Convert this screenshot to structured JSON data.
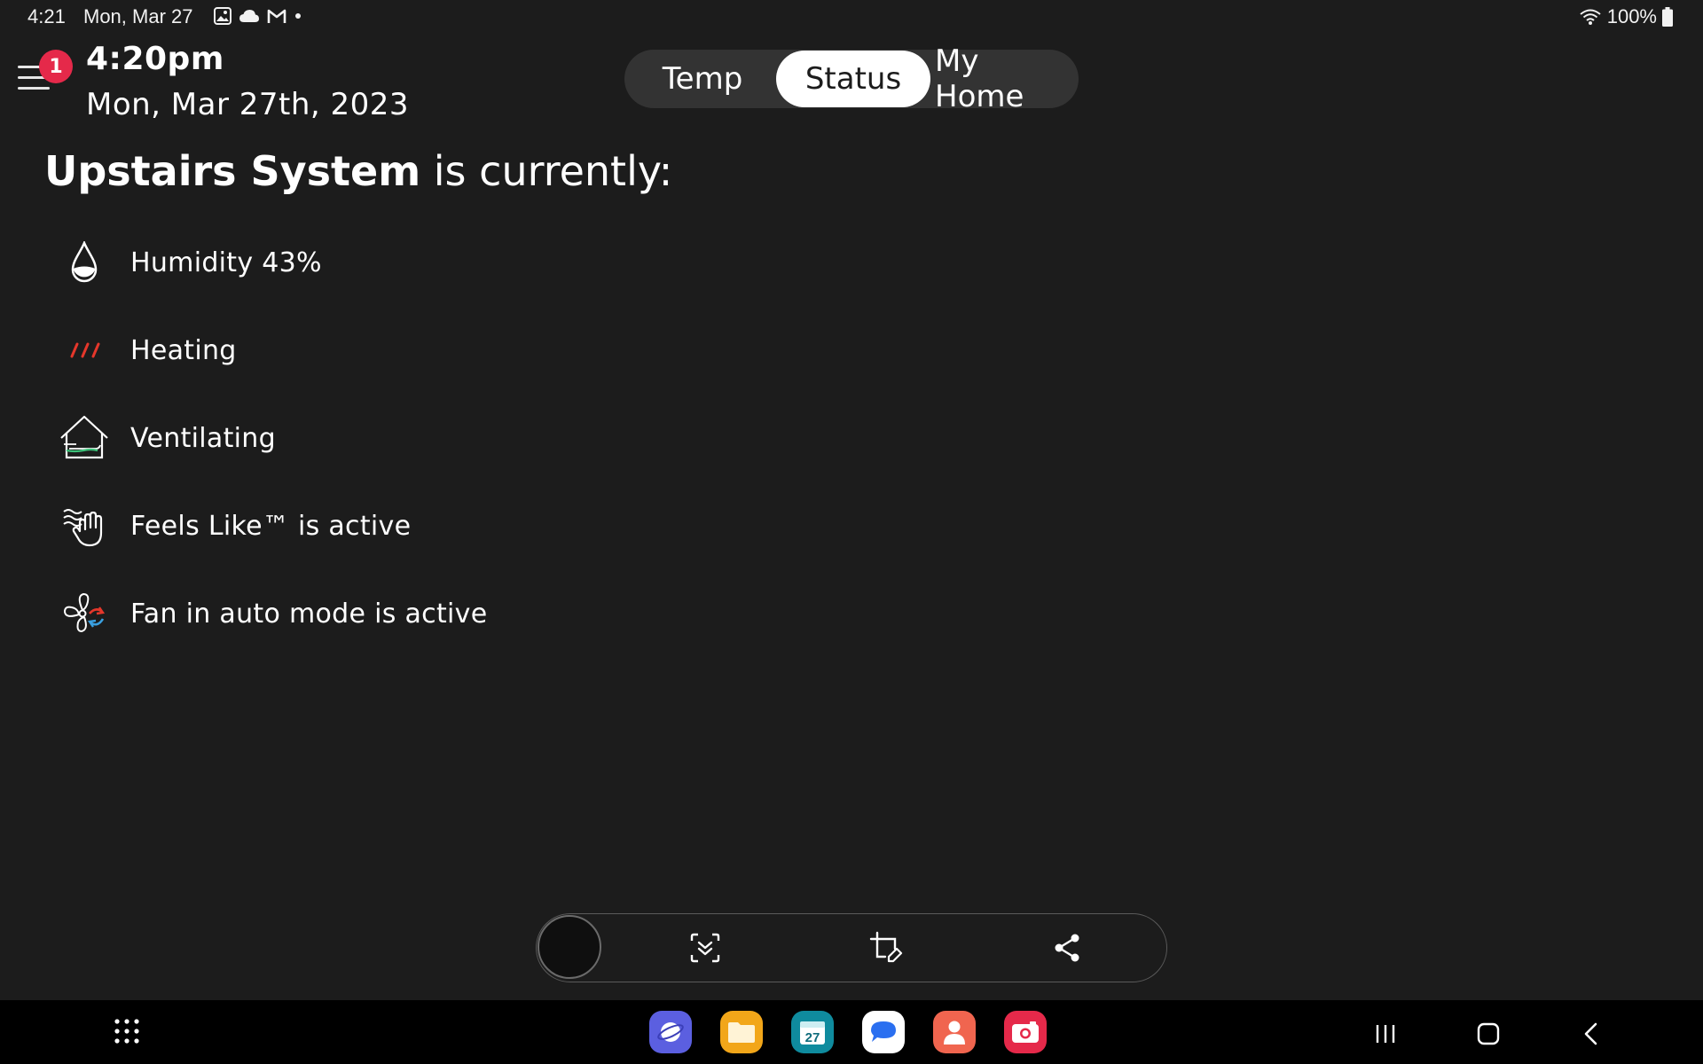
{
  "statusbar": {
    "time": "4:21",
    "date": "Mon, Mar 27",
    "battery": "100%",
    "icons": [
      "gallery-icon",
      "cloud-icon",
      "gmail-icon",
      "dot-icon",
      "wifi-icon",
      "battery-icon"
    ]
  },
  "header": {
    "notification_count": "1",
    "time": "4:20pm",
    "date": "Mon, Mar 27th, 2023"
  },
  "tabs": [
    {
      "label": "Temp",
      "selected": false
    },
    {
      "label": "Status",
      "selected": true
    },
    {
      "label": "My Home",
      "selected": false
    }
  ],
  "system": {
    "name": "Upstairs System",
    "suffix": " is currently:"
  },
  "status_items": [
    {
      "icon": "water-drop-icon",
      "label": "Humidity 43%"
    },
    {
      "icon": "heating-icon",
      "label": "Heating"
    },
    {
      "icon": "ventilation-house-icon",
      "label": "Ventilating"
    },
    {
      "icon": "feels-like-hand-icon",
      "label": "Feels Like™ is active"
    },
    {
      "icon": "fan-auto-icon",
      "label": "Fan in auto mode is active"
    }
  ],
  "screenshot_toolbar": {
    "tools": [
      "scroll-capture-icon",
      "crop-edit-icon",
      "share-icon"
    ]
  },
  "dock": {
    "apps": [
      {
        "name": "internet",
        "color": "#5b5fe0"
      },
      {
        "name": "my-files",
        "color": "#f2a619"
      },
      {
        "name": "calendar",
        "color": "#0f8b9e",
        "text": "27"
      },
      {
        "name": "messages",
        "color": "#ffffff"
      },
      {
        "name": "contacts",
        "color": "#f0654f"
      },
      {
        "name": "camera",
        "color": "#e5294a"
      }
    ]
  },
  "colors": {
    "background": "#1c1c1c",
    "accent_red": "#e5294a",
    "heating_red": "#e5372b",
    "vent_green": "#3ec27a"
  }
}
